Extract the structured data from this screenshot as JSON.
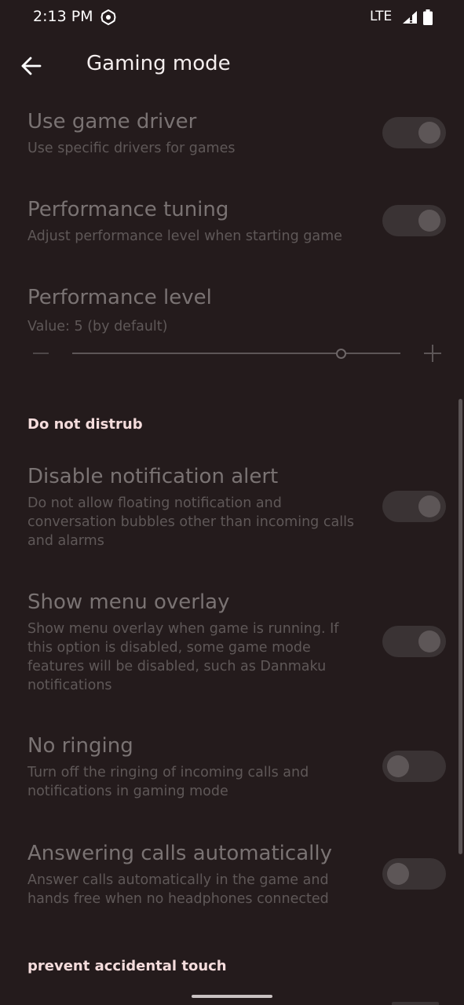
{
  "status_bar": {
    "time": "2:13 PM",
    "network": "LTE"
  },
  "app_bar": {
    "title": "Gaming mode"
  },
  "settings": {
    "game_driver": {
      "title": "Use game driver",
      "summary": "Use specific drivers for games",
      "enabled": true
    },
    "performance_tuning": {
      "title": "Performance tuning",
      "summary": "Adjust performance level when starting game",
      "enabled": true
    },
    "performance_level": {
      "title": "Performance level",
      "summary": "Value: 5  (by default)",
      "value": 5,
      "fraction": 0.82
    },
    "dnd_header": "Do not distrub",
    "disable_notification_alert": {
      "title": "Disable notification alert",
      "summary": "Do not allow floating notification and conversation bubbles other than incoming calls and alarms",
      "enabled": true
    },
    "show_menu_overlay": {
      "title": "Show menu overlay",
      "summary": "Show menu overlay when game is running. If this option is disabled, some game mode features will be disabled, such as Danmaku notifications",
      "enabled": true
    },
    "no_ringing": {
      "title": "No ringing",
      "summary": "Turn off the ringing of incoming calls and notifications in gaming mode",
      "enabled": false
    },
    "auto_answer": {
      "title": "Answering calls automatically",
      "summary": "Answer calls automatically in the game and hands free when no headphones connected",
      "enabled": false
    },
    "touch_header": "prevent accidental touch"
  }
}
